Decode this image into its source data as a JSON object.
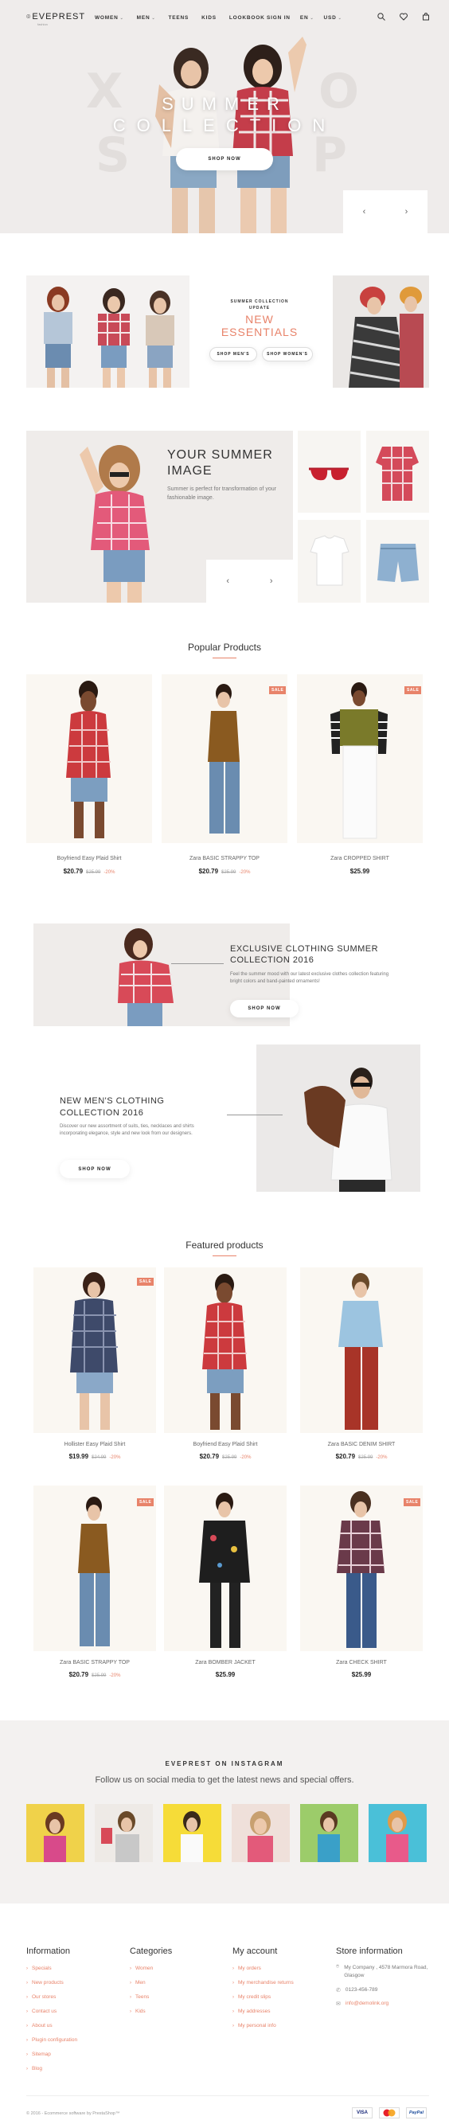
{
  "header": {
    "logo": "EVEPREST",
    "logo_sub": "fashion",
    "nav": [
      "WOMEN",
      "MEN",
      "TEENS",
      "KIDS",
      "LOOKBOOK"
    ],
    "sign_in": "SIGN IN",
    "lang": "EN",
    "currency": "USD"
  },
  "hero": {
    "title": "SUMMER",
    "subtitle": "COLLECTION",
    "bg_letters": [
      "X",
      "O",
      "S",
      "P"
    ],
    "button": "SHOP NOW"
  },
  "essentials": {
    "kicker": "SUMMER COLLECTION UPDATE",
    "title_1": "NEW",
    "title_2": "ESSENTIALS",
    "btn_mens": "SHOP MEN'S",
    "btn_womens": "SHOP WOMEN'S"
  },
  "summer_image": {
    "title_1": "YOUR SUMMER",
    "title_2": "IMAGE",
    "text": "Summer is perfect for transformation of your fashionable image."
  },
  "popular": {
    "title": "Popular Products",
    "products": [
      {
        "name": "Boyfriend Easy Plaid Shirt",
        "price": "$20.79",
        "old": "$25.99",
        "disc": "-20%",
        "sale": false
      },
      {
        "name": "Zara BASIC STRAPPY TOP",
        "price": "$20.79",
        "old": "$25.99",
        "disc": "-20%",
        "sale": true
      },
      {
        "name": "Zara CROPPED SHIRT",
        "price": "$25.99",
        "old": "",
        "disc": "",
        "sale": true
      }
    ]
  },
  "exclusive": {
    "title_1": "EXCLUSIVE CLOTHING SUMMER",
    "title_2": "COLLECTION 2016",
    "text": "Feel the summer mood with our latest exclusive clothes collection featuring bright colors and band-painted ornaments!",
    "button": "SHOP NOW"
  },
  "mens": {
    "title_1": "NEW MEN'S CLOTHING",
    "title_2": "COLLECTION 2016",
    "text": "Discover our new assortment of suits, ties, necklaces and shirts incorporating elegance, style and new look from our designers.",
    "button": "SHOP NOW"
  },
  "featured": {
    "title": "Featured products",
    "products": [
      {
        "name": "Hollister Easy Plaid Shirt",
        "price": "$19.99",
        "old": "$24.99",
        "disc": "-20%",
        "sale": true
      },
      {
        "name": "Boyfriend Easy Plaid Shirt",
        "price": "$20.79",
        "old": "$25.99",
        "disc": "-20%",
        "sale": false
      },
      {
        "name": "Zara BASIC DENIM SHIRT",
        "price": "$20.79",
        "old": "$25.99",
        "disc": "-20%",
        "sale": false
      },
      {
        "name": "Zara BASIC STRAPPY TOP",
        "price": "$20.79",
        "old": "$25.99",
        "disc": "-20%",
        "sale": true
      },
      {
        "name": "Zara BOMBER JACKET",
        "price": "$25.99",
        "old": "",
        "disc": "",
        "sale": false
      },
      {
        "name": "Zara CHECK SHIRT",
        "price": "$25.99",
        "old": "",
        "disc": "",
        "sale": true
      }
    ],
    "sale_label": "SALE"
  },
  "instagram": {
    "title": "EVEPREST ON INSTAGRAM",
    "subtitle": "Follow us on social media to get the latest news and special offers."
  },
  "footer": {
    "information": {
      "title": "Information",
      "links": [
        "Specials",
        "New products",
        "Our stores",
        "Contact us",
        "About us",
        "Plugin configuration",
        "Sitemap",
        "Blog"
      ]
    },
    "categories": {
      "title": "Categories",
      "links": [
        "Women",
        "Men",
        "Teens",
        "Kids"
      ]
    },
    "account": {
      "title": "My account",
      "links": [
        "My orders",
        "My merchandise returns",
        "My credit slips",
        "My addresses",
        "My personal info"
      ]
    },
    "store": {
      "title": "Store information",
      "address": "My Company , 4578 Marmora Road, Glasgow",
      "phone": "0123-456-789",
      "email": "info@demolink.org"
    },
    "copyright": "© 2016 - Ecommerce software by PrestaShop™",
    "payments": [
      "VISA",
      "MC",
      "PayPal"
    ]
  },
  "colors": {
    "accent": "#e8836a",
    "bg_light": "#f3f1f0"
  }
}
